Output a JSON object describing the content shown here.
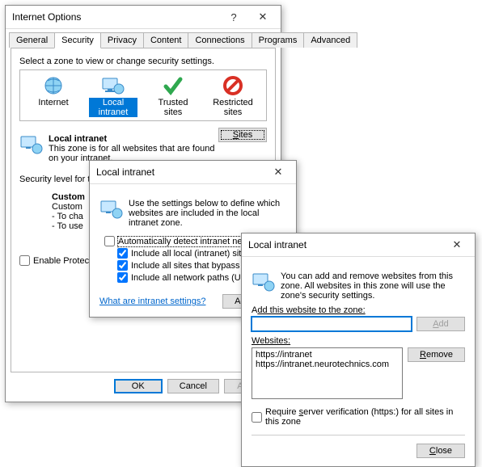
{
  "win1": {
    "title": "Internet Options",
    "help": "?",
    "tabs": [
      "General",
      "Security",
      "Privacy",
      "Content",
      "Connections",
      "Programs",
      "Advanced"
    ],
    "active_tab": "Security",
    "prompt": "Select a zone to view or change security settings.",
    "zones": {
      "internet": "Internet",
      "local": "Local intranet",
      "trusted": "Trusted sites",
      "restricted": "Restricted sites"
    },
    "zone_title": "Local intranet",
    "zone_desc": "This zone is for all websites that are found on your intranet.",
    "sites_btn": "Sites",
    "sec_level": "Security level for this",
    "custom": "Custom",
    "custom_l1": "Custom",
    "custom_l2": "- To cha",
    "custom_l3": "- To use",
    "protected": "Enable Protected",
    "ok": "OK",
    "cancel": "Cancel",
    "apply": "Apply"
  },
  "win2": {
    "title": "Local intranet",
    "desc": "Use the settings below to define which websites are included in the local intranet zone.",
    "auto": "Automatically detect intranet network",
    "c1": "Include all local (intranet) sites",
    "c2": "Include all sites that bypass th",
    "c3": "Include all network paths (UNC",
    "link": "What are intranet settings?",
    "advanced": "Advanced"
  },
  "win3": {
    "title": "Local intranet",
    "desc": "You can add and remove websites from this zone. All websites in this zone will use the zone's security settings.",
    "add_label_u": "d",
    "add_label": "d this website to the zone:",
    "add_btn_u": "A",
    "add_btn": "dd",
    "websites_label_u": "W",
    "websites_label": "ebsites:",
    "sites": [
      "https://intranet",
      "https://intranet.neurotechnics.com"
    ],
    "remove_u": "R",
    "remove": "emove",
    "require": "Require ",
    "require_u": "s",
    "require2": "erver verification (https:) for all sites in this zone",
    "close_u": "C",
    "close": "lose"
  }
}
